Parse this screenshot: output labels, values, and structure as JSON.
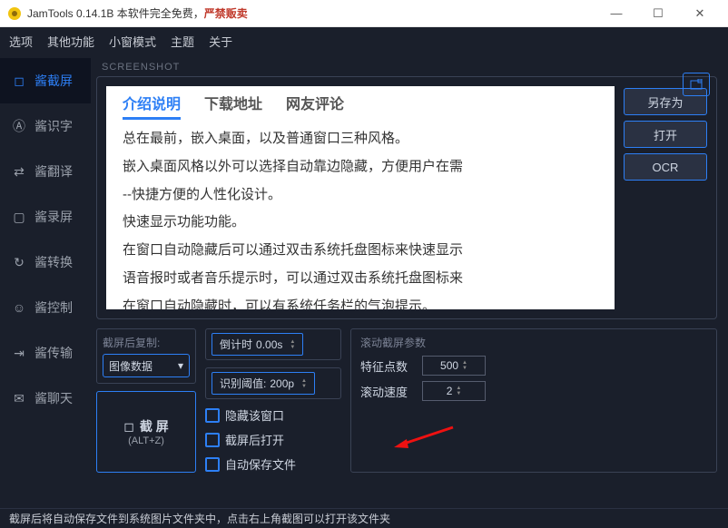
{
  "title": {
    "app": "JamTools 0.14.1B 本软件完全免费，",
    "warn": "严禁贩卖"
  },
  "win": {
    "min": "—",
    "max": "☐",
    "close": "✕"
  },
  "menu": [
    "选项",
    "其他功能",
    "小窗模式",
    "主题",
    "关于"
  ],
  "sidebar": [
    {
      "icon": "crop",
      "label": "酱截屏"
    },
    {
      "icon": "text",
      "label": "酱识字"
    },
    {
      "icon": "translate",
      "label": "酱翻译"
    },
    {
      "icon": "record",
      "label": "酱录屏"
    },
    {
      "icon": "convert",
      "label": "酱转换"
    },
    {
      "icon": "control",
      "label": "酱控制"
    },
    {
      "icon": "transfer",
      "label": "酱传输"
    },
    {
      "icon": "chat",
      "label": "酱聊天"
    }
  ],
  "section": "SCREENSHOT",
  "preview": {
    "tabs": [
      "介绍说明",
      "下载地址",
      "网友评论"
    ],
    "lines": [
      "总在最前，嵌入桌面，以及普通窗口三种风格。",
      "嵌入桌面风格以外可以选择自动靠边隐藏，方便用户在需",
      "--快捷方便的人性化设计。",
      "快速显示功能功能。",
      "在窗口自动隐藏后可以通过双击系统托盘图标来快速显示",
      "语音报时或者音乐提示时，可以通过双击系统托盘图标来",
      "在窗口自动隐藏时，可以有系统任务栏的气泡提示。"
    ]
  },
  "actions": [
    "另存为",
    "打开",
    "OCR"
  ],
  "copy": {
    "title": "截屏后复制:",
    "value": "图像数据",
    "arrow": "▾"
  },
  "bigbtn": {
    "label": "截 屏",
    "shortcut": "(ALT+Z)"
  },
  "mid": {
    "countdown_label": "倒计时",
    "countdown_val": "0.00s",
    "threshold_label": "识别阈值:",
    "threshold_val": "200p",
    "cb": [
      "隐藏该窗口",
      "截屏后打开",
      "自动保存文件"
    ]
  },
  "scroll": {
    "title": "滚动截屏参数",
    "row1_label": "特征点数",
    "row1_val": "500",
    "row2_label": "滚动速度",
    "row2_val": "2"
  },
  "status": "截屏后将自动保存文件到系统图片文件夹中，点击右上角截图可以打开该文件夹"
}
